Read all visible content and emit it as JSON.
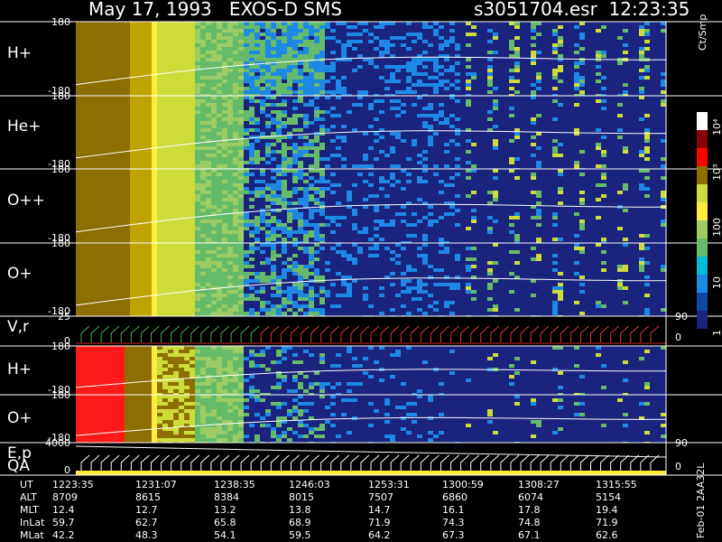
{
  "header": {
    "title": "May 17, 1993   EXOS-D SMS",
    "file_info": "s3051704.esr  12:23:35"
  },
  "colors": {
    "background": "#000000",
    "foreground": "#ffffff",
    "scale": [
      "#1a237e",
      "#0d47a1",
      "#1e88e5",
      "#00bcd4",
      "#66bb6a",
      "#9ccc65",
      "#cddc39",
      "#ffeb3b",
      "#f9a825",
      "#8d6e00",
      "#c62828",
      "#ff0000",
      "#ffffff"
    ]
  },
  "chart_data": [
    {
      "type": "heatmap",
      "label": "H+",
      "ytick_top": "180",
      "ytick_bottom": "-180"
    },
    {
      "type": "heatmap",
      "label": "He+",
      "ytick_top": "180",
      "ytick_bottom": "-180"
    },
    {
      "type": "heatmap",
      "label": "O++",
      "ytick_top": "180",
      "ytick_bottom": "-180"
    },
    {
      "type": "heatmap",
      "label": "O+",
      "ytick_top": "180",
      "ytick_bottom": "-180"
    },
    {
      "type": "line",
      "label": "V,r",
      "ytick_top": "25",
      "ytick_bottom": "0",
      "right_tick_top": "90",
      "right_tick_bottom": "0"
    },
    {
      "type": "heatmap",
      "label": "H+",
      "ytick_top": "180",
      "ytick_bottom": "-180"
    },
    {
      "type": "heatmap",
      "label": "O+",
      "ytick_top": "180",
      "ytick_bottom": "-180"
    },
    {
      "type": "line",
      "label": "E,p",
      "label2": "QA",
      "ytick_top": "4000",
      "ytick_bottom": "0",
      "right_tick_top": "90",
      "right_tick_bottom": "0"
    }
  ],
  "colorbar": {
    "label": "Ct/Smp",
    "ticks": [
      "10⁴",
      "10³",
      "100",
      "10",
      "1"
    ]
  },
  "ephemeris": {
    "rows": [
      {
        "name": "UT",
        "values": [
          "1223:35",
          "1231:07",
          "1238:35",
          "1246:03",
          "1253:31",
          "1300:59",
          "1308:27",
          "1315:55"
        ]
      },
      {
        "name": "ALT",
        "values": [
          "8709",
          "8615",
          "8384",
          "8015",
          "7507",
          "6860",
          "6074",
          "5154"
        ]
      },
      {
        "name": "MLT",
        "values": [
          "12.4",
          "12.7",
          "13.2",
          "13.8",
          "14.7",
          "16.1",
          "17.8",
          "19.4"
        ]
      },
      {
        "name": "InLat",
        "values": [
          "59.7",
          "62.7",
          "65.8",
          "68.9",
          "71.9",
          "74.3",
          "74.8",
          "71.9"
        ]
      },
      {
        "name": "MLat",
        "values": [
          "42.2",
          "48.3",
          "54.1",
          "59.5",
          "64.2",
          "67.3",
          "67.1",
          "62.6"
        ]
      }
    ]
  },
  "footer": "Feb-01 2AA32L"
}
